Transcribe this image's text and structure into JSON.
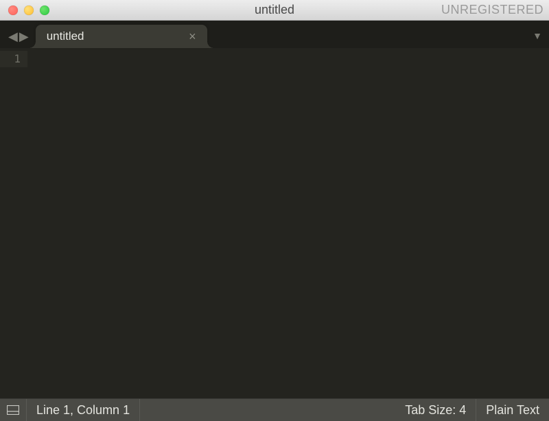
{
  "window": {
    "title": "untitled",
    "registration": "UNREGISTERED"
  },
  "tabs": [
    {
      "title": "untitled"
    }
  ],
  "editor": {
    "line_numbers": [
      "1"
    ]
  },
  "status": {
    "position": "Line 1, Column 1",
    "tab_size": "Tab Size: 4",
    "syntax": "Plain Text"
  }
}
